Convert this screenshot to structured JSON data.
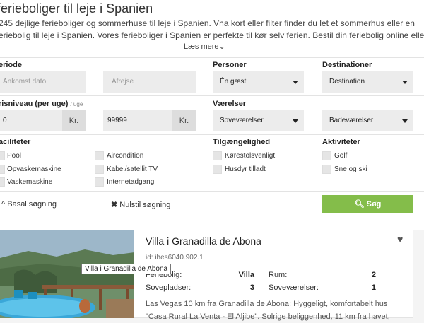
{
  "header": {
    "title": "ferieboliger til leje i Spanien",
    "intro_lines": [
      "245 dejlige ferieboliger og sommerhuse til leje i Spanien. Vha kort eller filter finder du let et sommerhus eller en",
      "eriebolig til leje i Spanien. Vores ferieboliger i Spanien er perfekte til kør selv ferien. Bestil din feriebolig online eller"
    ],
    "read_more": "Læs mere"
  },
  "filters": {
    "period_label": "eriode",
    "arrival_placeholder": "Ankomst dato",
    "departure_placeholder": "Afrejse",
    "persons_label": "Personer",
    "persons_value": "Én gæst",
    "destinations_label": "Destinationer",
    "destination_value": "Destination",
    "price_label": "risniveau (per uge)",
    "price_sub": "/ uge",
    "price_min": "0",
    "price_max": "99999",
    "currency": "Kr.",
    "rooms_label": "Værelser",
    "bedrooms_value": "Soveværelser",
    "bathrooms_value": "Badeværelser",
    "facilities_label": "aciliteter",
    "facilities_col1": [
      "Pool",
      "Opvaskemaskine",
      "Vaskemaskine"
    ],
    "facilities_col2": [
      "Aircondition",
      "Kabel/satellit TV",
      "Internetadgang"
    ],
    "accessibility_label": "Tilgængelighed",
    "accessibility": [
      "Kørestolsvenligt",
      "Husdyr tilladt"
    ],
    "activities_label": "Aktiviteter",
    "activities": [
      "Golf",
      "Sne og ski"
    ],
    "basic_search": "Basal søgning",
    "reset_search": "Nulstil søgning",
    "search_button": "Søg"
  },
  "listing": {
    "title": "Villa i Granadilla de Abona",
    "id_text": "id: ihes6040.902.1",
    "tooltip": "Villa i Granadilla de Abona",
    "type_label": "Feriebolig:",
    "type_value": "Villa",
    "rooms_label": "Rum:",
    "rooms_value": "2",
    "sleeps_label": "Sovepladser:",
    "sleeps_value": "3",
    "bedrooms_label": "Soveværelser:",
    "bedrooms_value": "1",
    "desc_lines": [
      "Las Vegas 10 km fra Granadilla de Abona: Hyggeligt, komfortabelt hus",
      "\"Casa Rural La Venta - El Aljibe\". Solrige beliggenhed, 11 km fra havet,"
    ]
  },
  "colors": {
    "accent": "#84bd4a",
    "field_bg": "#ececec"
  }
}
